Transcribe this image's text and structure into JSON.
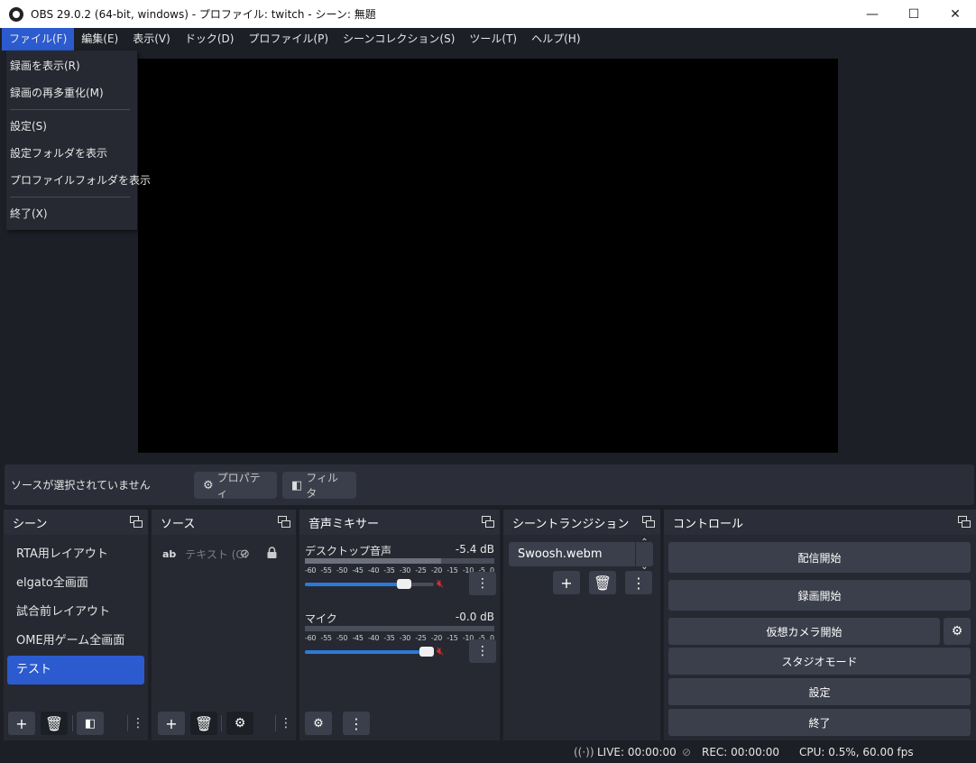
{
  "window": {
    "title": "OBS 29.0.2 (64-bit, windows) - プロファイル: twitch - シーン: 無題",
    "minimize": "—",
    "maximize": "☐",
    "close": "✕"
  },
  "menubar": [
    "ファイル(F)",
    "編集(E)",
    "表示(V)",
    "ドック(D)",
    "プロファイル(P)",
    "シーンコレクション(S)",
    "ツール(T)",
    "ヘルプ(H)"
  ],
  "file_menu": {
    "items": [
      "録画を表示(R)",
      "録画の再多重化(M)",
      "設定(S)",
      "設定フォルダを表示",
      "プロファイルフォルダを表示",
      "終了(X)"
    ]
  },
  "source_toolbar": {
    "no_selection": "ソースが選択されていません",
    "properties": "プロパティ",
    "filters": "フィルタ"
  },
  "scenes": {
    "title": "シーン",
    "items": [
      "RTA用レイアウト",
      "elgato全画面",
      "試合前レイアウト",
      "OME用ゲーム全画面",
      "テスト"
    ],
    "selected_index": 4
  },
  "sources": {
    "title": "ソース",
    "items": [
      {
        "type": "ab",
        "name": "テキスト (GI"
      }
    ]
  },
  "mixer": {
    "title": "音声ミキサー",
    "scale": [
      "-60",
      "-55",
      "-50",
      "-45",
      "-40",
      "-35",
      "-30",
      "-25",
      "-20",
      "-15",
      "-10",
      "-5",
      "0"
    ],
    "channels": [
      {
        "name": "デスクトップ音声",
        "db": "-5.4 dB",
        "level": 0.72,
        "volume": 0.8
      },
      {
        "name": "マイク",
        "db": "-0.0 dB",
        "level": 0.0,
        "volume": 1.0
      }
    ]
  },
  "transitions": {
    "title": "シーントランジション",
    "selected": "Swoosh.webm"
  },
  "controls": {
    "title": "コントロール",
    "start_stream": "配信開始",
    "start_record": "録画開始",
    "virtual_cam": "仮想カメラ開始",
    "studio_mode": "スタジオモード",
    "settings": "設定",
    "exit": "終了"
  },
  "status": {
    "live": "LIVE: 00:00:00",
    "rec": "REC: 00:00:00",
    "cpu": "CPU: 0.5%, 60.00 fps"
  },
  "colors": {
    "accent": "#2c5bd0",
    "background": "#1d1f26",
    "panel": "#262932",
    "button": "#3b3f4b",
    "mute_red": "#d63030"
  }
}
